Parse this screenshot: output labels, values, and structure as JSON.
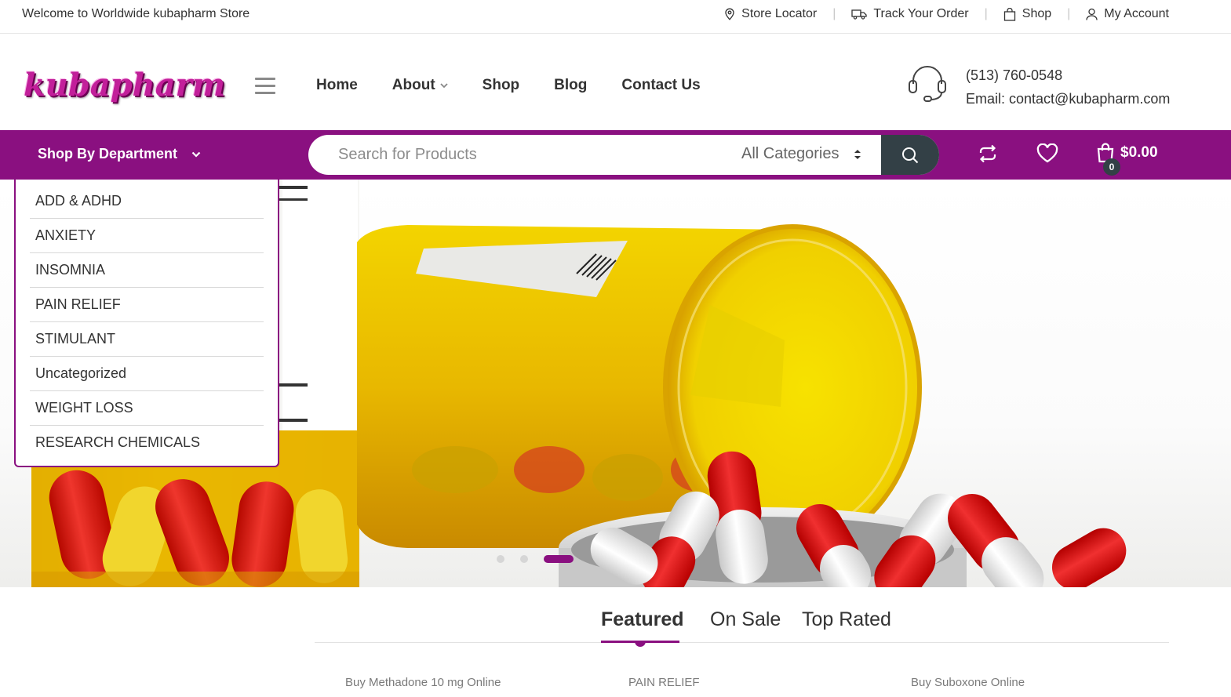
{
  "topbar": {
    "welcome": "Welcome to Worldwide kubapharm Store",
    "links": [
      {
        "label": "Store Locator",
        "icon": "map-pin-icon"
      },
      {
        "label": "Track Your Order",
        "icon": "truck-icon"
      },
      {
        "label": "Shop",
        "icon": "shopping-bag-icon"
      },
      {
        "label": "My Account",
        "icon": "user-icon"
      }
    ],
    "separator": "|"
  },
  "header": {
    "logo": "kubapharm",
    "nav": [
      {
        "label": "Home"
      },
      {
        "label": "About",
        "has_dropdown": true
      },
      {
        "label": "Shop"
      },
      {
        "label": "Blog"
      },
      {
        "label": "Contact Us"
      }
    ],
    "phone": "(513) 760-0548",
    "email": "Email: contact@kubapharm.com"
  },
  "bar": {
    "department_label": "Shop By Department",
    "search_placeholder": "Search for Products",
    "category_select": "All Categories",
    "cart_total": "$0.00",
    "cart_count": "0"
  },
  "departments": [
    "ADD & ADHD",
    "ANXIETY",
    "INSOMNIA",
    "PAIN RELIEF",
    "STIMULANT",
    "Uncategorized",
    "WEIGHT LOSS",
    "RESEARCH CHEMICALS"
  ],
  "slider": {
    "slides": 3,
    "active": 3
  },
  "tabs": [
    "Featured",
    "On Sale",
    "Top Rated"
  ],
  "products": [
    {
      "category": "Buy Methadone 10 mg Online"
    },
    {
      "category": "PAIN RELIEF"
    },
    {
      "category": "Buy Suboxone Online"
    }
  ],
  "colors": {
    "brand_purple": "#8a1080",
    "dark_slate": "#334046",
    "text": "#333333"
  }
}
